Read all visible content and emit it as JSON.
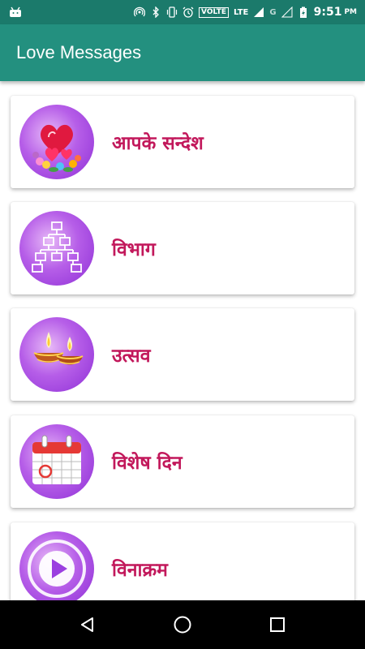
{
  "status_bar": {
    "volte": "VOLTE",
    "network": "LTE",
    "g": "G",
    "time": "9:51",
    "ampm": "PM"
  },
  "app_bar": {
    "title": "Love Messages"
  },
  "menu": {
    "items": [
      {
        "label": "आपके सन्देश",
        "icon": "hearts-flowers-icon"
      },
      {
        "label": "विभाग",
        "icon": "hierarchy-icon"
      },
      {
        "label": "उत्सव",
        "icon": "diya-lamp-icon"
      },
      {
        "label": "विशेष दिन",
        "icon": "calendar-icon"
      },
      {
        "label": "विनाक्रम",
        "icon": "play-icon"
      }
    ]
  },
  "colors": {
    "status_bar": "#1b7a6b",
    "app_bar": "#23907f",
    "label_text": "#c2185b",
    "icon_circle": "#a64ae0"
  }
}
